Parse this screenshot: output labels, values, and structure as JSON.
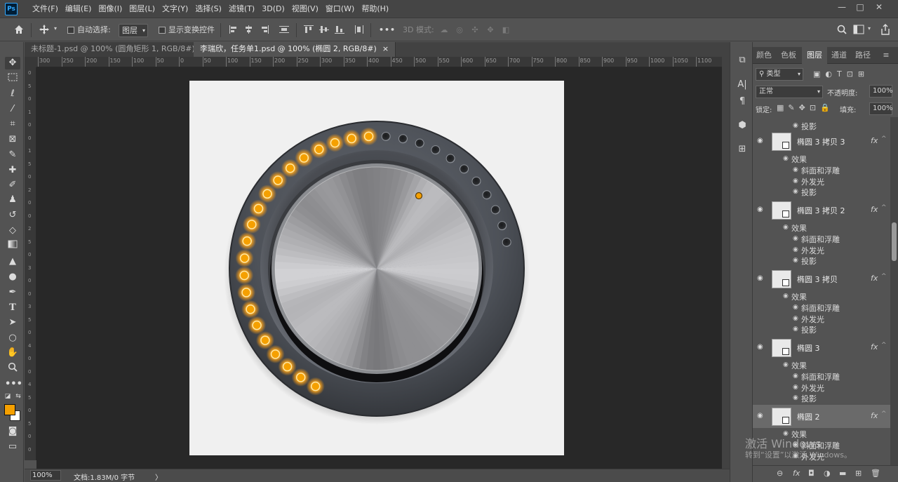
{
  "app": {
    "logo": "Ps"
  },
  "menu": [
    "文件(F)",
    "编辑(E)",
    "图像(I)",
    "图层(L)",
    "文字(Y)",
    "选择(S)",
    "滤镜(T)",
    "3D(D)",
    "视图(V)",
    "窗口(W)",
    "帮助(H)"
  ],
  "window_controls": {
    "minimize": "—",
    "maximize": "□",
    "close": "✕"
  },
  "options": {
    "home_icon": "home-icon",
    "move_icon": "move-icon",
    "auto_select_label": "自动选择:",
    "auto_select_target": "图层",
    "show_transform_label": "显示变换控件",
    "more": "•••",
    "mode_3d_label": "3D 模式:"
  },
  "tabs": [
    {
      "label": "未标题-1.psd @ 100% (圆角矩形 1, RGB/8#) *",
      "close": "×"
    },
    {
      "label": "李瑞欣，任务单1.psd @ 100% (椭圆 2, RGB/8#)",
      "close": "×"
    }
  ],
  "ruler_labels": [
    "300",
    "250",
    "200",
    "150",
    "100",
    "50",
    "0",
    "50",
    "100",
    "150",
    "200",
    "250",
    "300",
    "350",
    "400",
    "450",
    "500",
    "550",
    "600",
    "650",
    "700",
    "750",
    "800",
    "850",
    "900",
    "950",
    "1000",
    "1050",
    "1100"
  ],
  "ruler_v_labels": [
    "0",
    "5",
    "0",
    "1",
    "0",
    "0",
    "1",
    "5",
    "0",
    "2",
    "0",
    "0",
    "2",
    "5",
    "0",
    "3",
    "0",
    "0",
    "3",
    "5",
    "0",
    "4",
    "0",
    "0",
    "4",
    "5",
    "0",
    "5",
    "0",
    "0"
  ],
  "status": {
    "zoom": "100%",
    "doc_size": "文档:1.83M/0 字节",
    "arrow": "〉"
  },
  "panel": {
    "tabs": [
      "颜色",
      "色板",
      "图层",
      "通道",
      "路径"
    ],
    "active_tab": "图层",
    "filter_label": "类型",
    "blend_mode": "正常",
    "opacity_label": "不透明度:",
    "opacity_value": "100%",
    "lock_label": "锁定:",
    "fill_label": "填充:",
    "fill_value": "100%",
    "top_shadow": "投影",
    "layers": [
      {
        "name": "椭圆 3 拷贝 3",
        "fx": "fx",
        "effects_label": "效果",
        "effects": [
          "斜面和浮雕",
          "外发光",
          "投影"
        ]
      },
      {
        "name": "椭圆 3 拷贝 2",
        "fx": "fx",
        "effects_label": "效果",
        "effects": [
          "斜面和浮雕",
          "外发光",
          "投影"
        ]
      },
      {
        "name": "椭圆 3 拷贝",
        "fx": "fx",
        "effects_label": "效果",
        "effects": [
          "斜面和浮雕",
          "外发光",
          "投影"
        ]
      },
      {
        "name": "椭圆 3",
        "fx": "fx",
        "effects_label": "效果",
        "effects": [
          "斜面和浮雕",
          "外发光",
          "投影"
        ]
      },
      {
        "name": "椭圆 2",
        "fx": "fx",
        "effects_label": "效果",
        "effects": [
          "斜面和浮雕",
          "外发光"
        ]
      }
    ],
    "selected_layer": "椭圆 2"
  },
  "watermark": {
    "line1": "激活 Windows",
    "line2": "转到“设置”以激活 Windows。"
  },
  "colors": {
    "accent_orange": "#f5a000",
    "bg": "#535353",
    "canvas_bg": "#282828"
  }
}
